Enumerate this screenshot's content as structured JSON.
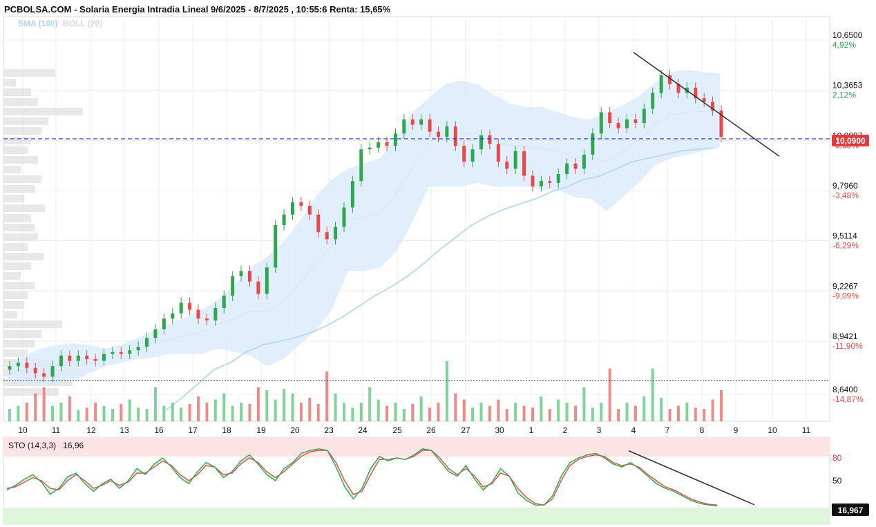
{
  "header": {
    "title": "PCBOLSA.COM - Solaria Energia Intradia Lineal 9/6/2025 - 8/7/2025 , 10:55:6 Renta: 15,65%",
    "sma_label": "SMA (100)",
    "boll_label": "BOLL (20)"
  },
  "colors": {
    "up": "#2fa64f",
    "down": "#e84a4a",
    "vol_up": "#7fd49a",
    "vol_down": "#f08a8a",
    "band": "#dcebfb",
    "sma": "#b9dcf6",
    "current_price_line": "#2233cc",
    "current_price_tag": "#e23b3b",
    "trendline": "#333333",
    "sto_k": "#2fa64f",
    "sto_d": "#e84a4a",
    "overbought_zone": "#fde4e4",
    "oversold_zone": "#dff6dc"
  },
  "chart_data": {
    "type": "candlestick",
    "x_tick_labels": [
      "10",
      "11",
      "12",
      "13",
      "16",
      "17",
      "18",
      "19",
      "20",
      "23",
      "24",
      "25",
      "26",
      "27",
      "30",
      "1",
      "2",
      "3",
      "4",
      "7",
      "8",
      "9",
      "10",
      "11"
    ],
    "y_ticks": [
      {
        "value": 10.65,
        "label": "10,6500",
        "pct": "4,92%",
        "pct_color": "#2fa64f"
      },
      {
        "value": 10.3653,
        "label": "10,3653",
        "pct": "2,12%",
        "pct_color": "#2fa64f"
      },
      {
        "value": 10.0807,
        "label": "10,0807",
        "pct": "-0,68%",
        "pct_color": "#e84a4a"
      },
      {
        "value": 9.796,
        "label": "9,7960",
        "pct": "-3,48%",
        "pct_color": "#e84a4a"
      },
      {
        "value": 9.5114,
        "label": "9,5114",
        "pct": "-6,29%",
        "pct_color": "#e84a4a"
      },
      {
        "value": 9.2267,
        "label": "9,2267",
        "pct": "-9,09%",
        "pct_color": "#e84a4a"
      },
      {
        "value": 8.9421,
        "label": "8,9421",
        "pct": "-11,90%",
        "pct_color": "#e84a4a"
      },
      {
        "value": 8.64,
        "label": "8,6400",
        "pct": "-14,87%",
        "pct_color": "#e84a4a"
      }
    ],
    "y_range": [
      8.64,
      10.65
    ],
    "current_price": 10.09,
    "current_price_label": "10,0900",
    "close_series": [
      8.8,
      8.82,
      8.79,
      8.76,
      8.74,
      8.8,
      8.86,
      8.83,
      8.86,
      8.84,
      8.83,
      8.87,
      8.88,
      8.87,
      8.89,
      8.91,
      8.96,
      9.01,
      9.07,
      9.1,
      9.16,
      9.12,
      9.07,
      9.06,
      9.13,
      9.2,
      9.31,
      9.34,
      9.28,
      9.21,
      9.36,
      9.6,
      9.66,
      9.73,
      9.71,
      9.66,
      9.56,
      9.52,
      9.59,
      9.7,
      9.85,
      10.03,
      10.04,
      10.07,
      10.05,
      10.12,
      10.2,
      10.17,
      10.2,
      10.13,
      10.1,
      10.16,
      10.05,
      9.96,
      10.03,
      10.11,
      10.06,
      9.96,
      9.92,
      10.02,
      9.88,
      9.82,
      9.85,
      9.84,
      9.89,
      9.95,
      9.92,
      10.0,
      10.12,
      10.24,
      10.18,
      10.15,
      10.2,
      10.18,
      10.26,
      10.35,
      10.45,
      10.4,
      10.35,
      10.38,
      10.32,
      10.3,
      10.25,
      10.1
    ],
    "boll_upper": [
      8.8,
      8.86,
      8.9,
      8.92,
      8.93,
      8.92,
      8.9,
      8.92,
      8.96,
      9.0,
      9.04,
      9.08,
      9.12,
      9.18,
      9.26,
      9.36,
      9.42,
      9.5,
      9.62,
      9.76,
      9.86,
      9.92,
      9.95,
      9.98,
      10.1,
      10.24,
      10.32,
      10.4,
      10.42,
      10.4,
      10.34,
      10.29,
      10.27,
      10.27,
      10.24,
      10.21,
      10.2,
      10.24,
      10.28,
      10.33,
      10.41,
      10.47,
      10.48,
      10.47,
      10.46
    ],
    "boll_lower": [
      8.72,
      8.7,
      8.7,
      8.7,
      8.72,
      8.76,
      8.8,
      8.82,
      8.84,
      8.85,
      8.87,
      8.87,
      8.87,
      8.9,
      8.88,
      8.86,
      8.8,
      8.84,
      8.92,
      9.0,
      9.12,
      9.34,
      9.34,
      9.36,
      9.45,
      9.62,
      9.82,
      9.82,
      9.82,
      9.84,
      9.82,
      9.82,
      9.82,
      9.8,
      9.8,
      9.76,
      9.75,
      9.68,
      9.76,
      9.84,
      9.94,
      9.98,
      10.0,
      10.02,
      10.04
    ],
    "sma_100": [
      8.55,
      8.62,
      8.7,
      8.78,
      8.82,
      8.88,
      8.92,
      8.94,
      8.96,
      8.99,
      9.03,
      9.08,
      9.14,
      9.2,
      9.25,
      9.31,
      9.38,
      9.46,
      9.53,
      9.6,
      9.65,
      9.69,
      9.72,
      9.75,
      9.79,
      9.82,
      9.86,
      9.88,
      9.92,
      9.96,
      9.98,
      10.0,
      10.02,
      10.03,
      10.04
    ],
    "volume": [
      0.2,
      0.25,
      0.3,
      0.45,
      0.55,
      0.25,
      0.3,
      0.4,
      0.18,
      0.22,
      0.3,
      0.25,
      0.2,
      0.28,
      0.35,
      0.22,
      0.2,
      0.55,
      0.25,
      0.3,
      0.22,
      0.28,
      0.4,
      0.3,
      0.35,
      0.45,
      0.25,
      0.3,
      0.28,
      0.55,
      0.5,
      0.35,
      0.52,
      0.45,
      0.3,
      0.38,
      0.28,
      0.8,
      0.45,
      0.3,
      0.22,
      0.3,
      0.55,
      0.35,
      0.25,
      0.3,
      0.2,
      0.28,
      0.4,
      0.22,
      0.3,
      0.97,
      0.45,
      0.35,
      0.22,
      0.3,
      0.25,
      0.35,
      0.2,
      0.3,
      0.25,
      0.22,
      0.4,
      0.2,
      0.35,
      0.3,
      0.25,
      0.55,
      0.22,
      0.3,
      0.85,
      0.2,
      0.3,
      0.25,
      0.4,
      0.85,
      0.38,
      0.2,
      0.25,
      0.3,
      0.22,
      0.2,
      0.35,
      0.5
    ],
    "price_trendline": {
      "start": {
        "x_label": "4",
        "value": 10.58
      },
      "end": {
        "x_label": "10",
        "value": 10.03
      }
    },
    "stochastic": {
      "label": "STO (14,3,3)",
      "value_label": "16,96",
      "last_value_tag": "16,967",
      "levels": [
        {
          "value": 80,
          "label": "80"
        },
        {
          "value": 50,
          "label": "50"
        }
      ],
      "k": [
        38,
        44,
        52,
        58,
        48,
        32,
        40,
        55,
        60,
        46,
        36,
        46,
        52,
        40,
        50,
        66,
        58,
        72,
        80,
        68,
        54,
        46,
        62,
        74,
        68,
        54,
        62,
        76,
        84,
        72,
        58,
        50,
        66,
        74,
        86,
        90,
        92,
        90,
        68,
        42,
        26,
        40,
        66,
        82,
        76,
        80,
        78,
        84,
        92,
        90,
        76,
        62,
        56,
        70,
        52,
        38,
        48,
        66,
        56,
        34,
        24,
        18,
        18,
        30,
        56,
        74,
        80,
        84,
        86,
        80,
        72,
        68,
        74,
        66,
        56,
        46,
        40,
        36,
        30,
        24,
        20,
        18,
        17
      ],
      "d": [
        40,
        42,
        48,
        54,
        50,
        40,
        38,
        50,
        58,
        50,
        40,
        44,
        50,
        44,
        48,
        60,
        60,
        68,
        76,
        70,
        58,
        50,
        58,
        70,
        68,
        58,
        60,
        72,
        80,
        74,
        62,
        54,
        62,
        72,
        82,
        88,
        90,
        90,
        74,
        50,
        32,
        36,
        58,
        78,
        78,
        80,
        78,
        82,
        90,
        90,
        80,
        66,
        58,
        66,
        56,
        42,
        46,
        60,
        56,
        40,
        28,
        20,
        18,
        26,
        50,
        70,
        78,
        82,
        84,
        82,
        74,
        70,
        72,
        68,
        58,
        50,
        42,
        38,
        32,
        26,
        22,
        19,
        18
      ],
      "trendline": {
        "start_value": 84,
        "end_value": 22
      }
    }
  }
}
